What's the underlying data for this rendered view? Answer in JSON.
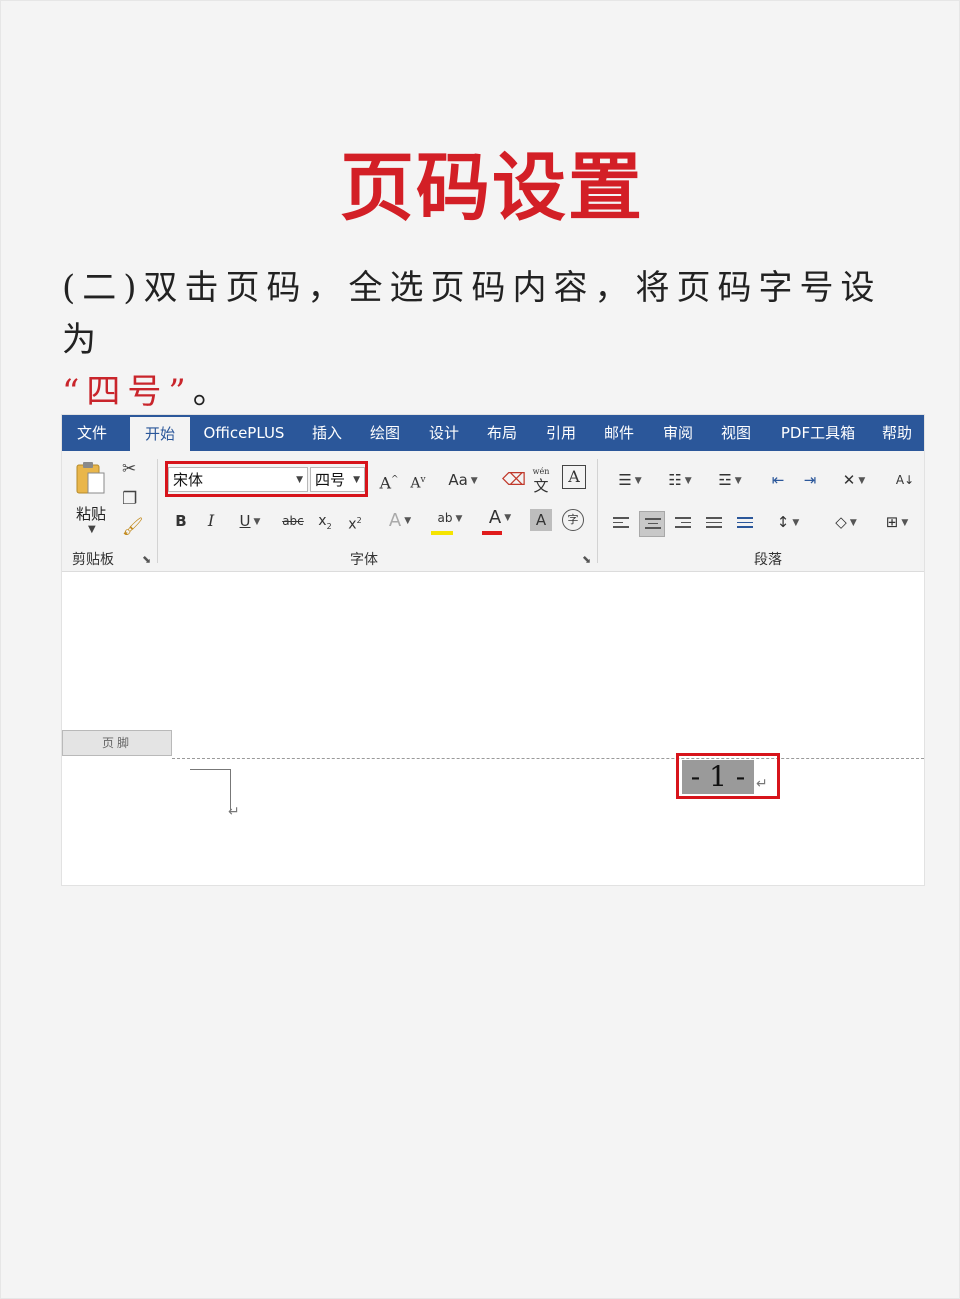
{
  "heading": "页码设置",
  "instruction": {
    "text": "(二)双击页码，全选页码内容，将页码字号设为",
    "highlight": "“四号”",
    "tail": "。"
  },
  "colors": {
    "accent": "#d31f26",
    "word_blue": "#2b579a",
    "outline_red": "#d7141b"
  },
  "menu": {
    "items": [
      "文件",
      "开始",
      "OfficePLUS",
      "插入",
      "绘图",
      "设计",
      "布局",
      "引用",
      "邮件",
      "审阅",
      "视图",
      "PDF工具箱",
      "帮助"
    ],
    "active": "开始"
  },
  "ribbon": {
    "clipboard": {
      "paste_label": "粘贴",
      "group_label": "剪贴板"
    },
    "font": {
      "font_name": "宋体",
      "font_size": "四号",
      "group_label": "字体",
      "grow": "A",
      "shrink": "A",
      "change_case": "Aa",
      "bold": "B",
      "italic": "I",
      "underline": "U",
      "strike": "abc",
      "subscript": "x",
      "superscript": "x",
      "sub_mark": "2",
      "sup_mark": "2",
      "text_effect": "A",
      "highlight": "ab",
      "font_color": "A",
      "char_shading": "A",
      "phonetic": "文",
      "phonetic_top": "wén",
      "char_border": "A",
      "enclose": "字"
    },
    "paragraph": {
      "group_label": "段落",
      "sort": "A↓"
    }
  },
  "document": {
    "footer_tag": "页脚",
    "page_number": "- 1 -",
    "para_mark": "↵"
  }
}
